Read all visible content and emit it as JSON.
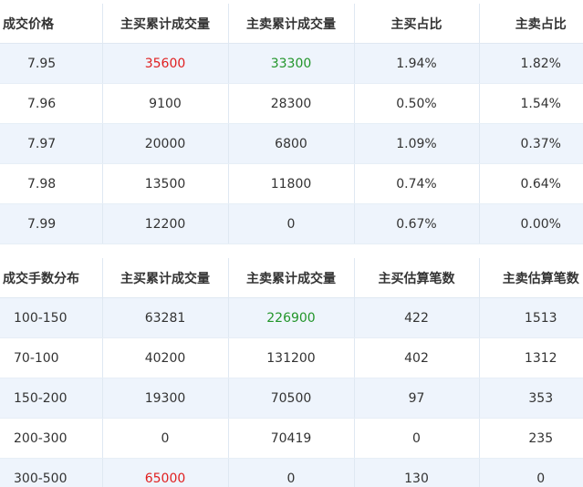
{
  "price_table": {
    "headers": [
      "成交价格",
      "主买累计成交量",
      "主卖累计成交量",
      "主买占比",
      "主卖占比"
    ],
    "rows": [
      {
        "price": "7.95",
        "buy_vol": "35600",
        "sell_vol": "33300",
        "buy_pct": "1.94%",
        "sell_pct": "1.82%",
        "buy_vol_color": "#e02020",
        "sell_vol_color": "#22952a"
      },
      {
        "price": "7.96",
        "buy_vol": "9100",
        "sell_vol": "28300",
        "buy_pct": "0.50%",
        "sell_pct": "1.54%"
      },
      {
        "price": "7.97",
        "buy_vol": "20000",
        "sell_vol": "6800",
        "buy_pct": "1.09%",
        "sell_pct": "0.37%"
      },
      {
        "price": "7.98",
        "buy_vol": "13500",
        "sell_vol": "11800",
        "buy_pct": "0.74%",
        "sell_pct": "0.64%"
      },
      {
        "price": "7.99",
        "buy_vol": "12200",
        "sell_vol": "0",
        "buy_pct": "0.67%",
        "sell_pct": "0.00%"
      }
    ]
  },
  "size_table": {
    "headers": [
      "成交手数分布",
      "主买累计成交量",
      "主卖累计成交量",
      "主买估算笔数",
      "主卖估算笔数"
    ],
    "rows": [
      {
        "range": "100-150",
        "buy_vol": "63281",
        "sell_vol": "226900",
        "buy_count": "422",
        "sell_count": "1513",
        "sell_vol_color": "#22952a"
      },
      {
        "range": "70-100",
        "buy_vol": "40200",
        "sell_vol": "131200",
        "buy_count": "402",
        "sell_count": "1312"
      },
      {
        "range": "150-200",
        "buy_vol": "19300",
        "sell_vol": "70500",
        "buy_count": "97",
        "sell_count": "353"
      },
      {
        "range": "200-300",
        "buy_vol": "0",
        "sell_vol": "70419",
        "buy_count": "0",
        "sell_count": "235"
      },
      {
        "range": "300-500",
        "buy_vol": "65000",
        "sell_vol": "0",
        "buy_count": "130",
        "sell_count": "0",
        "buy_vol_color": "#e02020"
      }
    ]
  },
  "colors": {
    "highlight_up": "#e02020",
    "highlight_down": "#22952a",
    "row_stripe": "#eef4fc",
    "border": "#dfe8f2"
  }
}
